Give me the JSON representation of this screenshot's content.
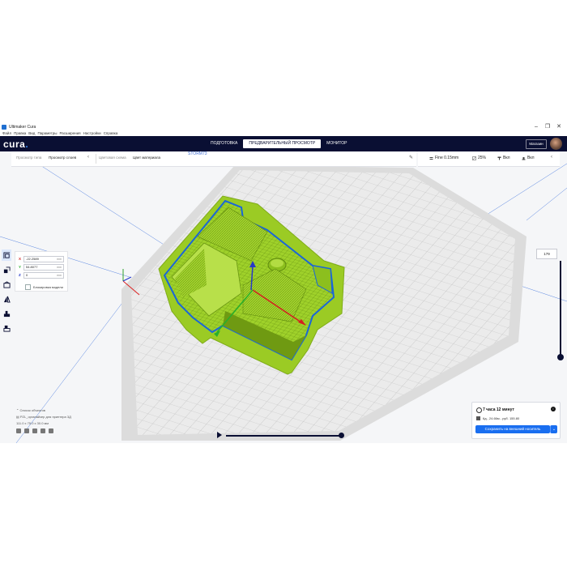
{
  "window": {
    "app_title": "Ultimaker Cura",
    "controls": [
      "–",
      "❐",
      "✕"
    ]
  },
  "menu": [
    "Файл",
    "Правка",
    "Вид",
    "Параметры",
    "Расширения",
    "Настройки",
    "Справка"
  ],
  "header": {
    "logo_text": "cura",
    "logo_dot": ".",
    "tabs": [
      "ПОДГОТОВКА",
      "ПРЕДВАРИТЕЛЬНЫЙ ПРОСМОТР",
      "МОНИТОР"
    ],
    "active_tab": "ПРЕДВАРИТЕЛЬНЫЙ ПРОСМОТР",
    "store_label": "Магазин"
  },
  "view_toolbar": {
    "view_type_label": "Просмотр типа",
    "view_type_value": "Просмотр слоев",
    "color_scheme_label": "Цветовая схема",
    "color_scheme_value": "Цвет материала",
    "filename": "STORM73"
  },
  "print_settings": {
    "profile": "Fine 0.15mm",
    "infill": "25%",
    "support": "Вкл",
    "adhesion": "Вкл"
  },
  "move_panel": {
    "x_label": "X",
    "x_value": "-22.2589",
    "x_unit": "mm",
    "y_label": "Y",
    "y_value": "54.8077",
    "y_unit": "mm",
    "z_label": "Z",
    "z_value": "0",
    "z_unit": "mm",
    "lock_label": "Блокировка модели"
  },
  "tools": [
    "move-tool-icon",
    "scale-tool-icon",
    "rotate-tool-icon",
    "mirror-tool-icon",
    "per-model-settings-icon",
    "support-blocker-icon"
  ],
  "object_list": {
    "header": "Список объектов",
    "file": "PZL_органайзер для принтера 3Д",
    "dims": "111.0 x 75.0 x 30.0 мм"
  },
  "layer_slider": {
    "current_layer": "179",
    "fraction": 1.0
  },
  "simulation": {
    "progress_fraction": 1.0
  },
  "print_info": {
    "time": "7 часа 12 минут",
    "material": "6д., 24.66м - руб. 155.80",
    "save_label": "Сохранить на внешний носитель"
  },
  "colors": {
    "header_bg": "#0a0f33",
    "accent": "#196ef0",
    "model_fill": "#9fd12a",
    "model_dark": "#6f9a12",
    "outer_wall": "#1a66d8",
    "build_plate": "#f2f2f2",
    "grid": "#c8c8c8"
  }
}
